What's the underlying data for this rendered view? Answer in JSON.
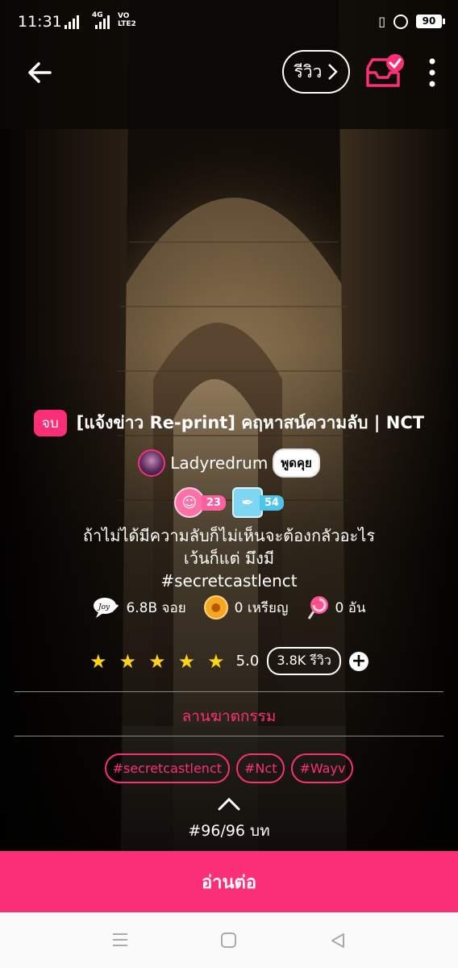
{
  "status_bar": {
    "time": "11:31",
    "network": "4G",
    "volte": "VO LTE2",
    "battery": "90"
  },
  "top_bar": {
    "review_label": "รีวิว"
  },
  "story": {
    "end_badge": "จบ",
    "title": "[แจ้งข่าว Re-print] คฤหาสน์ความลับ | NCT",
    "author": "Ladyredrum",
    "chat_label": "พูดคุย",
    "badge_level": "23",
    "badge_writer": "54",
    "description_line1": "ถ้าไม่ได้มีความลับก็ไม่เห็นจะต้องกลัวอะไร",
    "description_line2": "เว้นก็แต่ มึงมี",
    "description_line3": "#secretcastlenct"
  },
  "stats": {
    "joy": "6.8B จอย",
    "coins": "0 เหรียญ",
    "lollipop": "0 อัน"
  },
  "rating": {
    "value": "5.0",
    "reviews": "3.8K รีวิว",
    "stars": 5
  },
  "genre": "ลานฆาตกรรม",
  "tags": [
    "#secretcastlenct",
    "#Nct",
    "#Wayv"
  ],
  "episodes": "#96/96 บท",
  "read_button": "อ่านต่อ",
  "colors": {
    "accent": "#fb2f77",
    "star": "#ffd21a"
  }
}
